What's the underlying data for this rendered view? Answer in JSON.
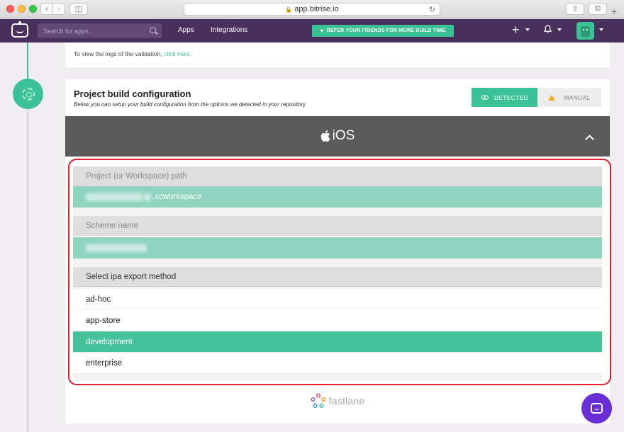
{
  "browser": {
    "url": "app.bitrise.io"
  },
  "nav": {
    "search_placeholder": "Search for apps...",
    "links": [
      "Apps",
      "Integrations"
    ],
    "refer_text": "REFER YOUR FRIENDS FOR MORE BUILD TIME"
  },
  "validation": {
    "logs_text": "To view the logs of the validation,",
    "logs_link": "click here."
  },
  "build_config": {
    "title": "Project build configuration",
    "subtitle": "Below you can setup your build configuration from the options we detected in your repository",
    "toggle_detected": "DETECTED",
    "toggle_manual": "MANUAL",
    "platform": "iOS",
    "project_path_label": "Project (or Workspace) path",
    "project_path_value": ".xcworkspace",
    "scheme_label": "Scheme name",
    "scheme_value": "",
    "export_label": "Select ipa export method",
    "export_options": [
      "ad-hoc",
      "app-store",
      "development",
      "enterprise"
    ],
    "selected_export": "development",
    "footer_brand": "fastlane"
  },
  "colors": {
    "nav_bg": "#492f5c",
    "accent": "#3bc196",
    "selected_row": "#46c29a",
    "value_row": "#8fd4bf",
    "platform_bar": "#5a5a5a",
    "highlight_outline": "#e5202b",
    "chat_button": "#6a2ed6"
  },
  "icons": [
    "sidebar-icon",
    "lock-icon",
    "reload-icon",
    "share-icon",
    "tabs-icon",
    "bitrise-logo-icon",
    "search-icon",
    "heart-icon",
    "plus-icon",
    "bell-icon",
    "avatar-robot-icon",
    "gear-icon",
    "eye-icon",
    "warning-icon",
    "apple-icon",
    "chevron-up-icon",
    "fastlane-icon",
    "chat-icon"
  ]
}
